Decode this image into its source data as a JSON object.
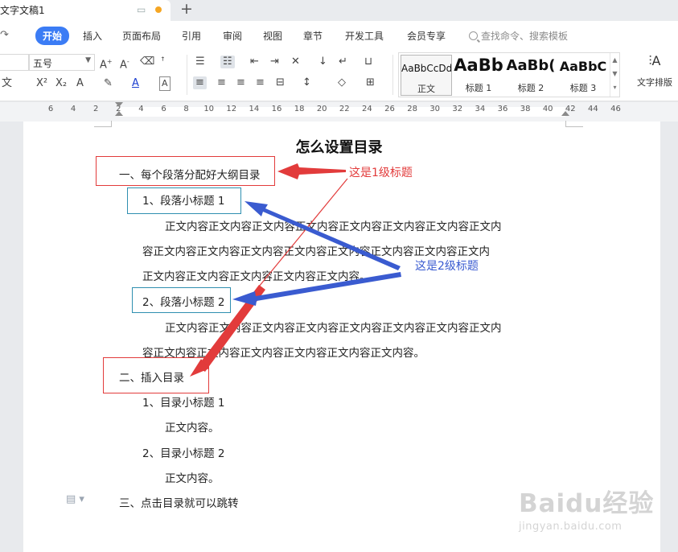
{
  "titlebar": {
    "doc_tab_label": "文字文稿1"
  },
  "menu": {
    "items": [
      "开始",
      "插入",
      "页面布局",
      "引用",
      "审阅",
      "视图",
      "章节",
      "开发工具",
      "会员专享"
    ],
    "active": "开始",
    "search_placeholder": "查找命令、搜索模板"
  },
  "ribbon": {
    "font_size": "五号",
    "styles": [
      {
        "sample": "AaBbCcDd",
        "name": "正文"
      },
      {
        "sample": "AaBb",
        "name": "标题 1"
      },
      {
        "sample": "AaBb(",
        "name": "标题 2"
      },
      {
        "sample": "AaBbC",
        "name": "标题 3"
      }
    ],
    "text_layout_label": "文字排版"
  },
  "ruler": {
    "numbers": [
      "6",
      "4",
      "2",
      "2",
      "4",
      "6",
      "8",
      "10",
      "12",
      "14",
      "16",
      "18",
      "20",
      "22",
      "24",
      "26",
      "28",
      "30",
      "32",
      "34",
      "36",
      "38",
      "40",
      "42",
      "44",
      "46"
    ]
  },
  "document": {
    "title": "怎么设置目录",
    "heading1_a": "一、每个段落分配好大纲目录",
    "sub1": "1、段落小标题 1",
    "para1_lines": [
      "正文内容正文内容正文内容正文内容正文内容正文内容正文内容正文内",
      "容正文内容正文内容正文内容正文内容正文内容正文内容正文内容正文内",
      "正文内容正文内容正文内容正文内容正文内容。"
    ],
    "sub2": "2、段落小标题 2",
    "para2_lines": [
      "正文内容正文内容正文内容正文内容正文内容正文内容正文内容正文内",
      "容正文内容正文内容正文内容正文内容正文内容正文内容。"
    ],
    "heading1_b": "二、插入目录",
    "toc1": "1、目录小标题 1",
    "toc1_body": "正文内容。",
    "toc2": "2、目录小标题 2",
    "toc2_body": "正文内容。",
    "heading1_c": "三、点击目录就可以跳转"
  },
  "annotations": {
    "level1_label": "这是1级标题",
    "level2_label": "这是2级标题",
    "level1_color": "#e23b3b",
    "level2_color": "#3a5bd0"
  },
  "watermark": {
    "logo": "Baidu经验",
    "url": "jingyan.baidu.com"
  }
}
